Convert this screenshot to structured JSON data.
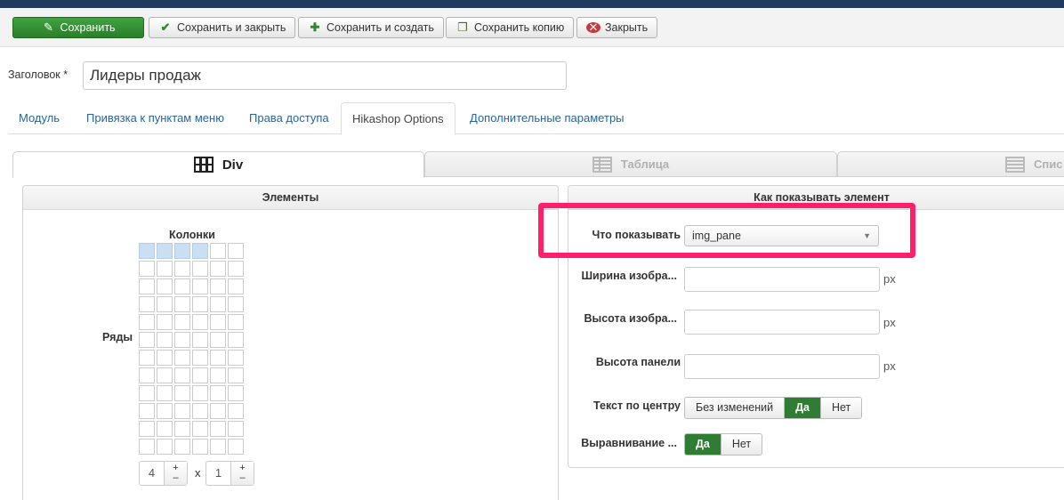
{
  "toolbar": {
    "save": "Сохранить",
    "save_close": "Сохранить и закрыть",
    "save_new": "Сохранить и создать",
    "save_copy": "Сохранить копию",
    "close": "Закрыть"
  },
  "title_field": {
    "label": "Заголовок *",
    "value": "Лидеры продаж"
  },
  "tabs": [
    "Модуль",
    "Привязка к пунктам меню",
    "Права доступа",
    "Hikashop Options",
    "Дополнительные параметры"
  ],
  "active_tab": "Hikashop Options",
  "subtabs": [
    "Div",
    "Таблица",
    "Спис"
  ],
  "elements_panel": {
    "title": "Элементы",
    "columns_label": "Колонки",
    "rows_label": "Ряды",
    "columns_value": "4",
    "rows_value": "1",
    "times": "x",
    "plus": "+",
    "minus": "–"
  },
  "display_panel": {
    "title": "Как показывать элемент",
    "what_to_show_label": "Что показывать",
    "what_to_show_value": "img_pane",
    "image_width_label": "Ширина изобра...",
    "image_height_label": "Высота изобра...",
    "panel_height_label": "Высота панели",
    "unit": "px",
    "center_text_label": "Текст по центру",
    "center_text_options": [
      "Без изменений",
      "Да",
      "Нет"
    ],
    "center_text_selected": "Да",
    "align_label": "Выравнивание ...",
    "align_options": [
      "Да",
      "Нет"
    ],
    "align_selected": "Да"
  },
  "colors": {
    "primary": "#2f7d32",
    "highlight": "#ff1f6a",
    "link": "#2a6496",
    "topbar": "#1e3a5f"
  }
}
